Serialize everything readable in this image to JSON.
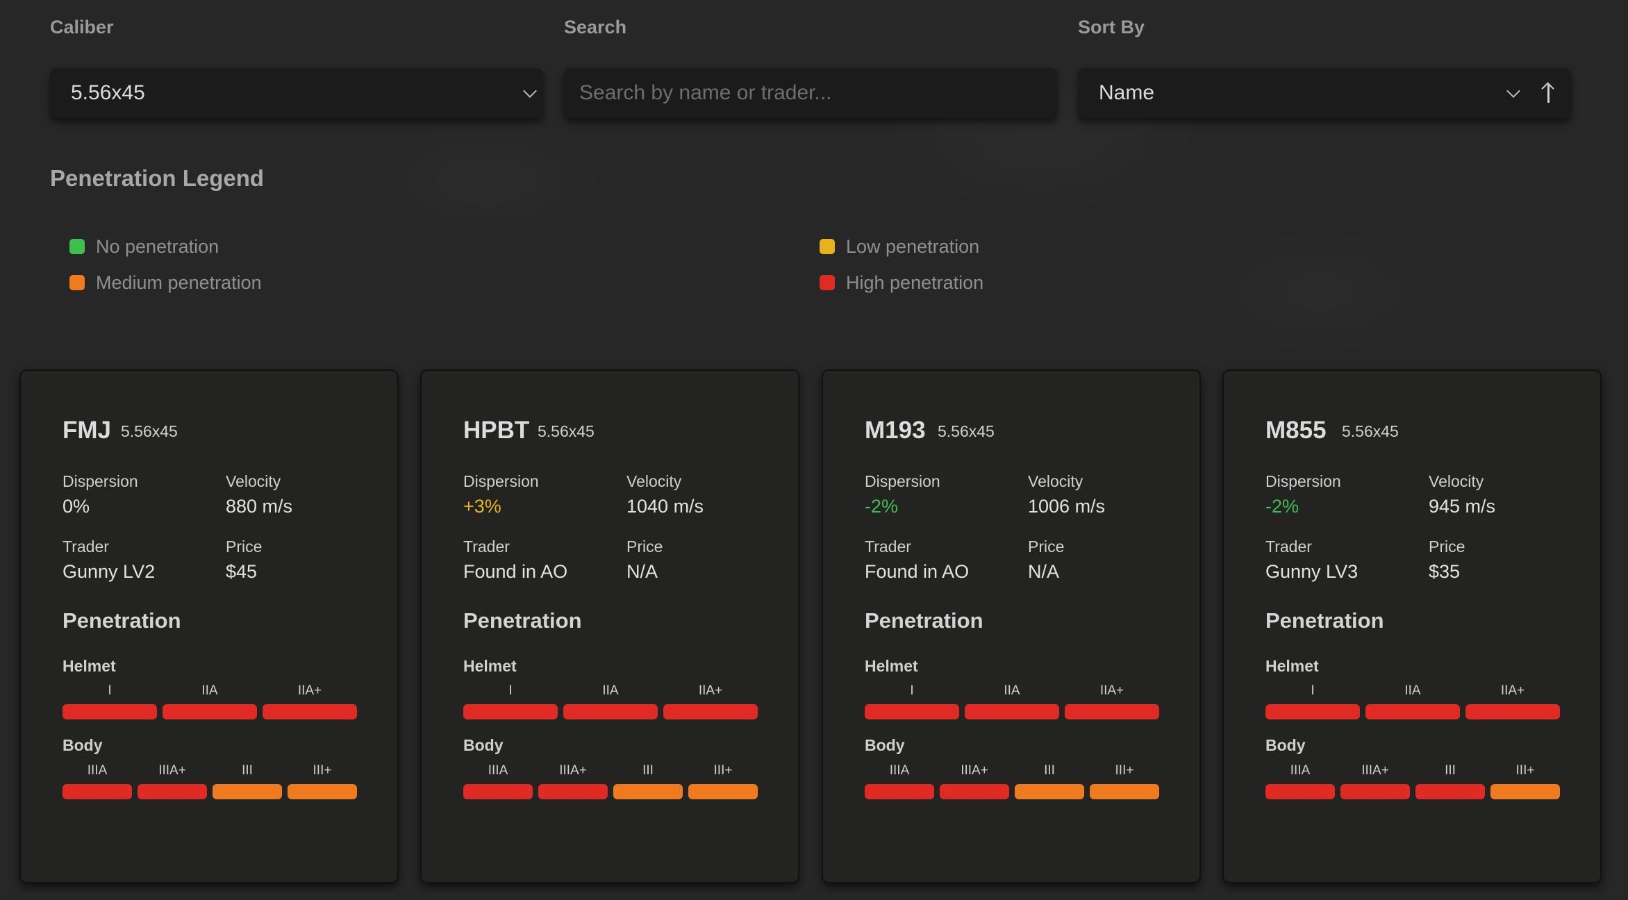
{
  "filters": {
    "caliber": {
      "label": "Caliber",
      "value": "5.56x45"
    },
    "search": {
      "label": "Search",
      "placeholder": "Search by name or trader..."
    },
    "sort": {
      "label": "Sort By",
      "value": "Name"
    }
  },
  "legend": {
    "title": "Penetration Legend",
    "items": [
      {
        "label": "No penetration",
        "color": "#3fbf4f"
      },
      {
        "label": "Low penetration",
        "color": "#e8b21c"
      },
      {
        "label": "Medium penetration",
        "color": "#f07a1e"
      },
      {
        "label": "High penetration",
        "color": "#e02b24"
      }
    ]
  },
  "labels": {
    "dispersion": "Dispersion",
    "velocity": "Velocity",
    "trader": "Trader",
    "price": "Price",
    "penetration": "Penetration",
    "helmet": "Helmet",
    "body": "Body"
  },
  "helmet_tiers": [
    "I",
    "IIA",
    "IIA+"
  ],
  "body_tiers": [
    "IIIA",
    "IIIA+",
    "III",
    "III+"
  ],
  "colors": {
    "high": "#e02b24",
    "medium": "#f07a1e",
    "low": "#e8b21c",
    "none": "#3fbf4f",
    "positive": "#e8b21c",
    "negative": "#3fbf4f"
  },
  "cards": [
    {
      "name": "FMJ",
      "caliber": "5.56x45",
      "dispersion": "0%",
      "dispersion_tone": "neutral",
      "velocity": "880 m/s",
      "trader": "Gunny LV2",
      "price": "$45",
      "helmet": [
        "high",
        "high",
        "high"
      ],
      "body": [
        "high",
        "high",
        "medium",
        "medium"
      ]
    },
    {
      "name": "HPBT",
      "caliber": "5.56x45",
      "dispersion": "+3%",
      "dispersion_tone": "positive",
      "velocity": "1040 m/s",
      "trader": "Found in AO",
      "price": "N/A",
      "helmet": [
        "high",
        "high",
        "high"
      ],
      "body": [
        "high",
        "high",
        "medium",
        "medium"
      ]
    },
    {
      "name": "M193",
      "caliber": "5.56x45",
      "dispersion": "-2%",
      "dispersion_tone": "negative",
      "velocity": "1006 m/s",
      "trader": "Found in AO",
      "price": "N/A",
      "helmet": [
        "high",
        "high",
        "high"
      ],
      "body": [
        "high",
        "high",
        "medium",
        "medium"
      ]
    },
    {
      "name": "M855",
      "caliber": "5.56x45",
      "dispersion": "-2%",
      "dispersion_tone": "negative",
      "velocity": "945 m/s",
      "trader": "Gunny LV3",
      "price": "$35",
      "helmet": [
        "high",
        "high",
        "high"
      ],
      "body": [
        "high",
        "high",
        "high",
        "medium"
      ]
    }
  ]
}
